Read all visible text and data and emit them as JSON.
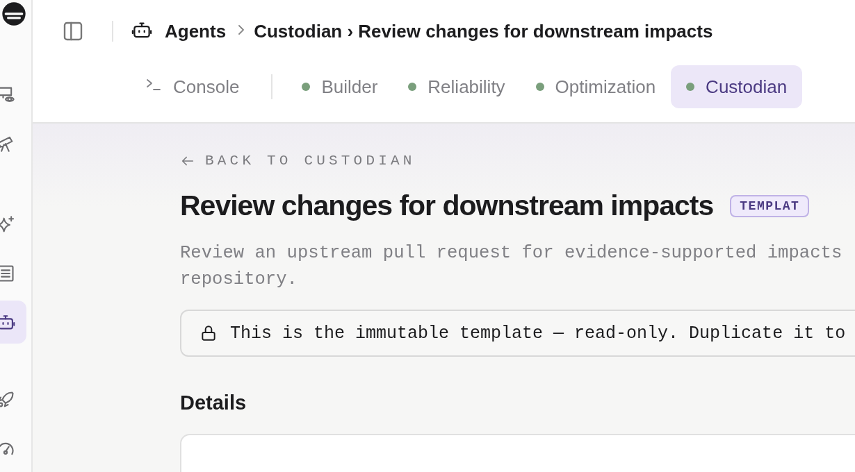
{
  "sidebar": {
    "items": [
      {
        "selected": false
      },
      {
        "selected": false
      },
      {
        "selected": false
      },
      {
        "selected": false
      },
      {
        "selected": true
      },
      {
        "selected": false
      },
      {
        "selected": false
      }
    ]
  },
  "breadcrumb": [
    "Agents",
    "Custodian › Review changes for downstream impacts"
  ],
  "tabs": [
    {
      "label": "Console",
      "kind": "terminal",
      "selected": false
    },
    {
      "label": "Builder",
      "kind": "status",
      "selected": false
    },
    {
      "label": "Reliability",
      "kind": "status",
      "selected": false
    },
    {
      "label": "Optimization",
      "kind": "status",
      "selected": false
    },
    {
      "label": "Custodian",
      "kind": "status",
      "selected": true
    }
  ],
  "back_link": "BACK TO CUSTODIAN",
  "title": "Review changes for downstream impacts",
  "badge": "TEMPLAT",
  "description": [
    "Review an upstream pull request for evidence-supported impacts",
    "repository."
  ],
  "notice": "This is the immutable template — read-only. Duplicate it to",
  "section_title": "Details"
}
